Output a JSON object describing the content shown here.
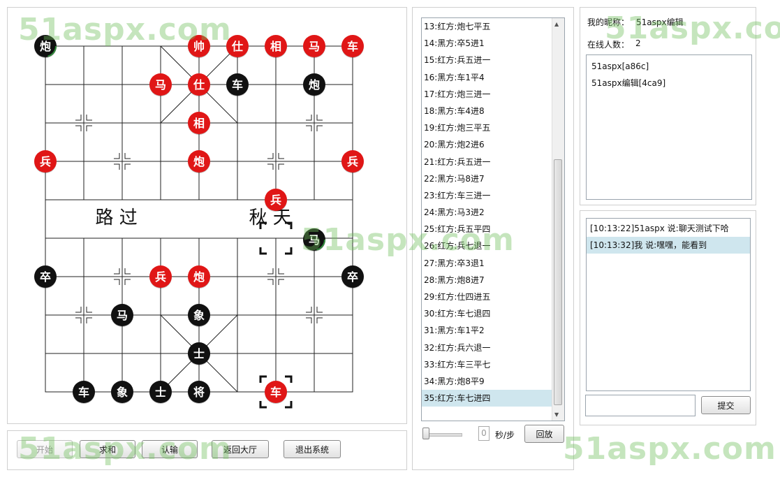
{
  "board": {
    "river_left": "路 过",
    "river_right": "秋 天",
    "pieces": [
      {
        "side": "black",
        "label": "炮",
        "file": 0,
        "rank": 0,
        "highlight": true
      },
      {
        "side": "red",
        "label": "帅",
        "file": 4,
        "rank": 0
      },
      {
        "side": "red",
        "label": "仕",
        "file": 5,
        "rank": 0
      },
      {
        "side": "red",
        "label": "相",
        "file": 6,
        "rank": 0
      },
      {
        "side": "red",
        "label": "马",
        "file": 7,
        "rank": 0
      },
      {
        "side": "red",
        "label": "车",
        "file": 8,
        "rank": 0
      },
      {
        "side": "red",
        "label": "马",
        "file": 3,
        "rank": 1
      },
      {
        "side": "red",
        "label": "仕",
        "file": 4,
        "rank": 1
      },
      {
        "side": "black",
        "label": "车",
        "file": 5,
        "rank": 1
      },
      {
        "side": "black",
        "label": "炮",
        "file": 7,
        "rank": 1
      },
      {
        "side": "red",
        "label": "相",
        "file": 4,
        "rank": 2
      },
      {
        "side": "red",
        "label": "兵",
        "file": 0,
        "rank": 3
      },
      {
        "side": "red",
        "label": "炮",
        "file": 4,
        "rank": 3
      },
      {
        "side": "red",
        "label": "兵",
        "file": 8,
        "rank": 3
      },
      {
        "side": "red",
        "label": "兵",
        "file": 6,
        "rank": 4
      },
      {
        "side": "black",
        "label": "马",
        "file": 7,
        "rank": 5,
        "highlight": true,
        "offset": true
      },
      {
        "side": "black",
        "label": "卒",
        "file": 0,
        "rank": 6
      },
      {
        "side": "red",
        "label": "兵",
        "file": 3,
        "rank": 6
      },
      {
        "side": "red",
        "label": "炮",
        "file": 4,
        "rank": 6
      },
      {
        "side": "black",
        "label": "卒",
        "file": 8,
        "rank": 6
      },
      {
        "side": "black",
        "label": "马",
        "file": 2,
        "rank": 7
      },
      {
        "side": "black",
        "label": "象",
        "file": 4,
        "rank": 7
      },
      {
        "side": "black",
        "label": "士",
        "file": 4,
        "rank": 8
      },
      {
        "side": "black",
        "label": "车",
        "file": 1,
        "rank": 9
      },
      {
        "side": "black",
        "label": "象",
        "file": 2,
        "rank": 9
      },
      {
        "side": "black",
        "label": "士",
        "file": 3,
        "rank": 9
      },
      {
        "side": "black",
        "label": "将",
        "file": 4,
        "rank": 9
      },
      {
        "side": "red",
        "label": "车",
        "file": 6,
        "rank": 9
      }
    ],
    "last_move": {
      "from": {
        "file": 6,
        "rank": 5
      },
      "to": {
        "file": 6,
        "rank": 9
      }
    }
  },
  "controls": {
    "start": "开始",
    "draw": "求和",
    "resign": "认输",
    "back_to_lobby": "返回大厅",
    "exit": "退出系统"
  },
  "moves": [
    "13:红方:炮七平五",
    "14:黑方:卒5进1",
    "15:红方:兵五进一",
    "16:黑方:车1平4",
    "17:红方:炮三进一",
    "18:黑方:车4进8",
    "19:红方:炮三平五",
    "20:黑方:炮2进6",
    "21:红方:兵五进一",
    "22:黑方:马8进7",
    "23:红方:车三进一",
    "24:黑方:马3进2",
    "25:红方:兵五平四",
    "26:红方:兵七退一",
    "27:黑方:卒3退1",
    "28:黑方:炮8进7",
    "29:红方:仕四进五",
    "30:红方:车七退四",
    "31:黑方:车1平2",
    "32:红方:兵六退一",
    "33:红方:车三平七",
    "34:黑方:炮8平9",
    "35:红方:车七进四"
  ],
  "selected_move": 22,
  "replay": {
    "seconds_value": "0",
    "unit": "秒/步",
    "button": "回放"
  },
  "info": {
    "nickname_label": "我的昵称：",
    "nickname": "51aspx编辑",
    "online_label": "在线人数：",
    "online_count": "2",
    "users": [
      "51aspx[a86c]",
      "51aspx编辑[4ca9]"
    ]
  },
  "chat": {
    "messages": [
      "[10:13:22]51aspx 说:聊天测试下哈",
      "[10:13:32]我 说:嘿嘿，能看到"
    ],
    "selected": 1,
    "input_value": "",
    "submit": "提交"
  },
  "watermark": "51aspx.com",
  "colors": {
    "red_piece": "#e01616",
    "black_piece": "#111111",
    "selection": "#cfe6ee",
    "watermark": "#6ebe5a"
  }
}
